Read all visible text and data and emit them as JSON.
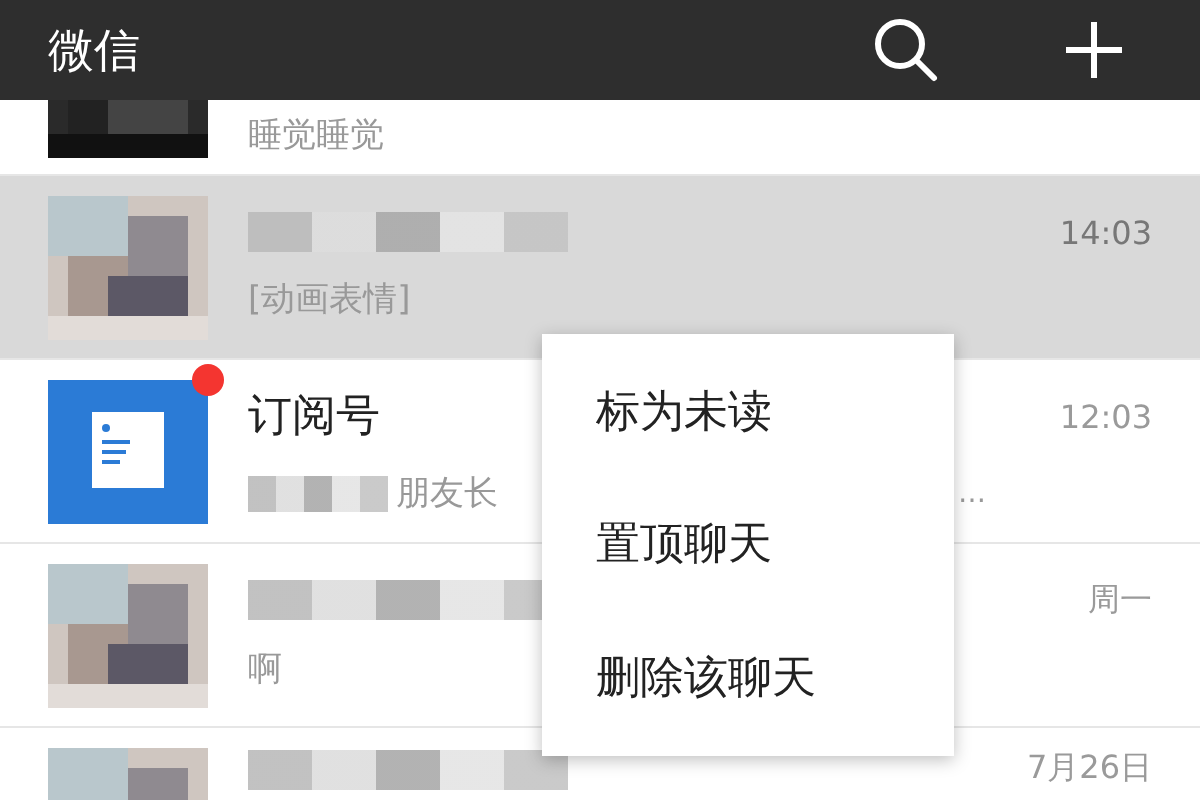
{
  "header": {
    "title": "微信"
  },
  "chats": [
    {
      "preview": "睡觉睡觉",
      "selected": false,
      "unread": false
    },
    {
      "name_redacted": true,
      "preview": "[动画表情]",
      "time": "14:03",
      "selected": true,
      "unread": false
    },
    {
      "avatar": {
        "kind": "subscription"
      },
      "name": "订阅号",
      "preview_redacted": true,
      "preview": "朋友长",
      "preview_tail": "…",
      "time": "12:03",
      "selected": false,
      "unread": true
    },
    {
      "name_redacted": true,
      "preview": "啊",
      "time": "周一",
      "selected": false,
      "unread": false
    },
    {
      "name_redacted": true,
      "time": "7月26日",
      "selected": false,
      "unread": false
    }
  ],
  "context_menu": [
    "标为未读",
    "置顶聊天",
    "删除该聊天"
  ]
}
